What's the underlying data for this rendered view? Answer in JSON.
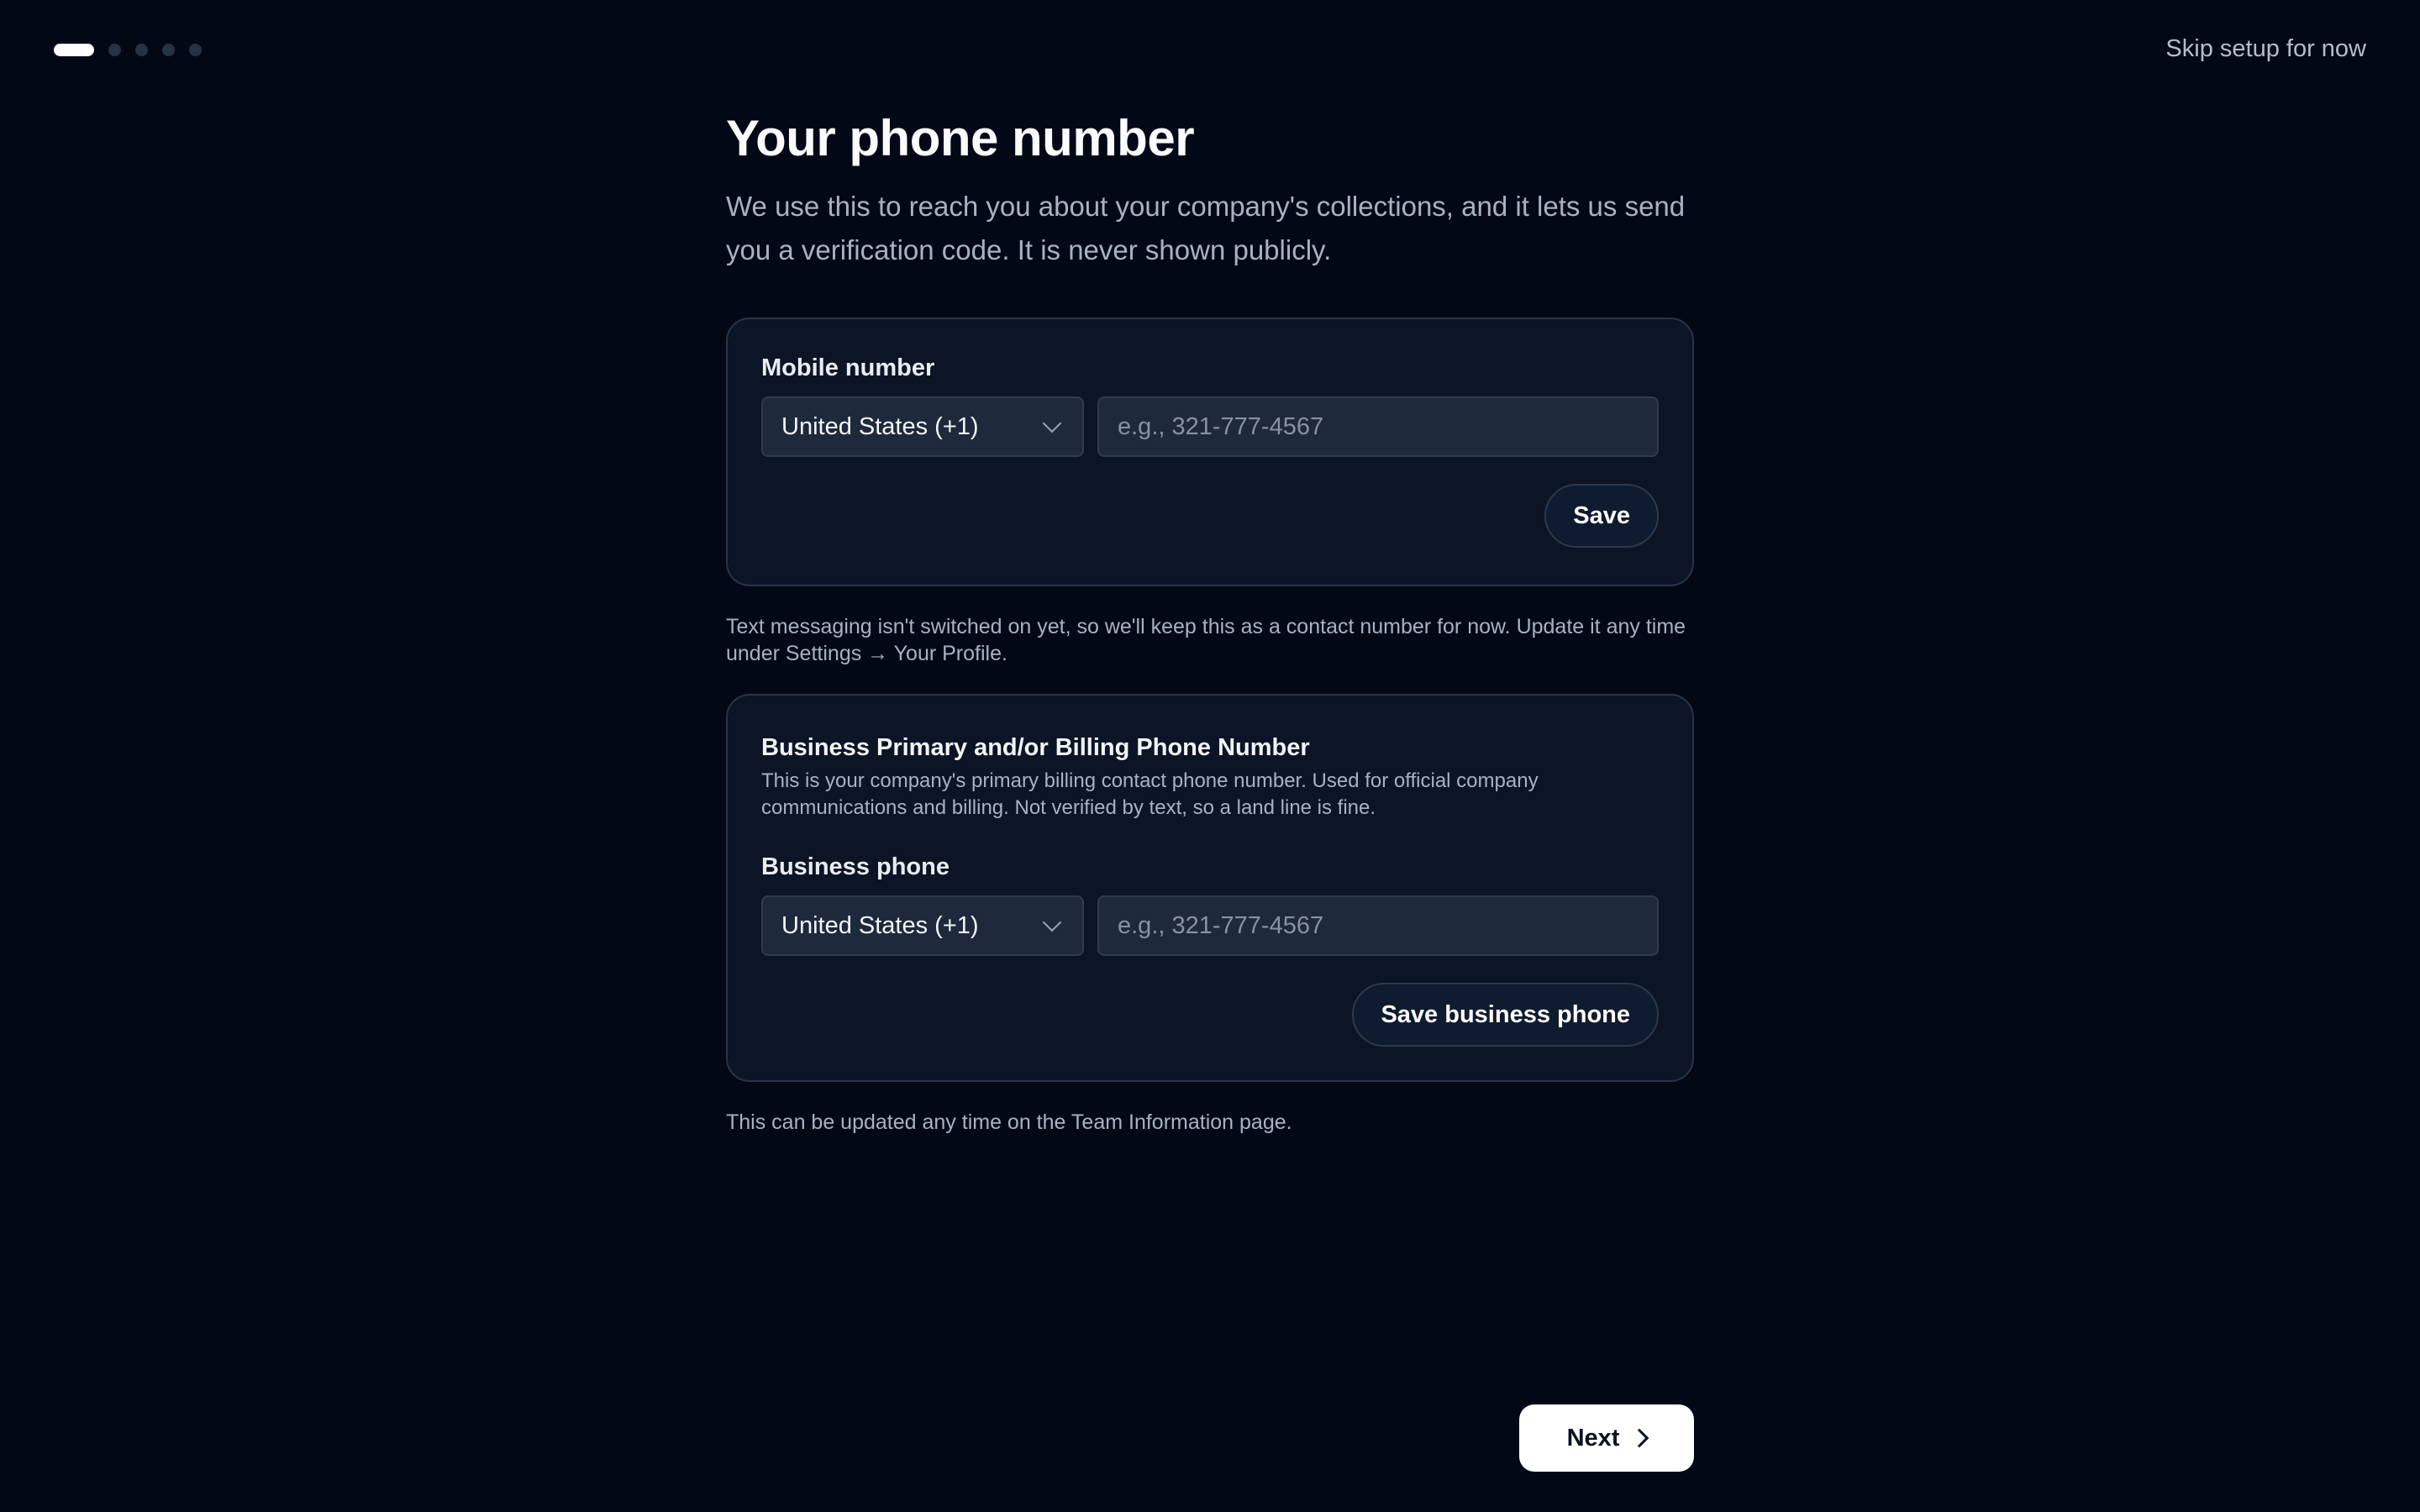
{
  "header": {
    "progress_steps": 5,
    "active_step": 1,
    "skip_label": "Skip setup for now"
  },
  "main": {
    "title": "Your phone number",
    "subtitle": "We use this to reach you about your company's collections, and it lets us send you a verification code. It is never shown publicly."
  },
  "mobile": {
    "label": "Mobile number",
    "country": "United States (+1)",
    "placeholder": "e.g., 321-777-4567",
    "value": "",
    "save_label": "Save",
    "note": "Text messaging isn't switched on yet, so we'll keep this as a contact number for now. Update it any time under Settings → Your Profile."
  },
  "business": {
    "title": "Business Primary and/or Billing Phone Number",
    "description": "This is your company's primary billing contact phone number. Used for official company communications and billing. Not verified by text, so a land line is fine.",
    "label": "Business phone",
    "country": "United States (+1)",
    "placeholder": "e.g., 321-777-4567",
    "value": "",
    "save_label": "Save business phone",
    "note": "This can be updated any time on the Team Information page."
  },
  "footer": {
    "next_label": "Next"
  },
  "colors": {
    "background": "#030817",
    "card": "#0c1526",
    "input": "#1e293b",
    "primary_button": "#ffffff"
  },
  "icons": {
    "select_chevron": "chevron-down-icon",
    "next_chevron": "chevron-right-icon"
  }
}
